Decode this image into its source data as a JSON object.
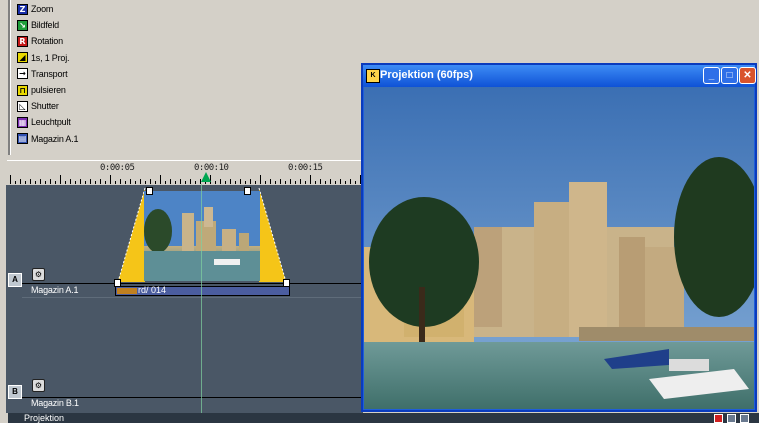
{
  "tools": [
    {
      "label": "Zoom",
      "icon": "zoom-icon",
      "glyph": "Z",
      "color": "#1a2fa8"
    },
    {
      "label": "Bildfeld",
      "icon": "image-field-icon",
      "glyph": "↘",
      "color": "#1e9e3a"
    },
    {
      "label": "Rotation",
      "icon": "rotation-icon",
      "glyph": "R",
      "color": "#c41818"
    },
    {
      "label": "1s, 1 Proj.",
      "icon": "projection-ramp-icon",
      "glyph": "◢",
      "color": "#e8d800"
    },
    {
      "label": "Transport",
      "icon": "transport-arrow-icon",
      "glyph": "→",
      "color": "#ffffff"
    },
    {
      "label": "pulsieren",
      "icon": "pulse-icon",
      "glyph": "⊓",
      "color": "#e8d800"
    },
    {
      "label": "Shutter",
      "icon": "shutter-icon",
      "glyph": "◺",
      "color": "#ffffff"
    },
    {
      "label": "Leuchtpult",
      "icon": "light-table-icon",
      "glyph": "▦",
      "color": "#7b2bb0"
    },
    {
      "label": "Magazin A.1",
      "icon": "magazine-icon",
      "glyph": "▤",
      "color": "#3050b0"
    }
  ],
  "ruler": {
    "labels": [
      "0:00:05",
      "0:00:10",
      "0:00:15"
    ]
  },
  "tracks": [
    {
      "letter": "A",
      "name": "Magazin A.1",
      "gear": "⚙"
    },
    {
      "letter": "B",
      "name": "Magazin B.1",
      "gear": "⚙"
    }
  ],
  "clip": {
    "label": "rd/ 014"
  },
  "projection_window": {
    "title": "Projektion (60fps)",
    "app_icon": "K",
    "minimize": "_",
    "maximize": "□",
    "close": "✕"
  },
  "status": {
    "label": "Projektion"
  },
  "colors": {
    "timeline_bg": "#4a5766",
    "title_bar": "#0f52d6",
    "clip_bar": "#4b5d9f",
    "fade": "#f5c518",
    "playhead": "#00a651"
  }
}
